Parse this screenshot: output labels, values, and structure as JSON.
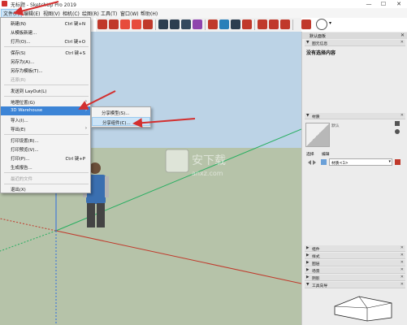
{
  "window": {
    "title": "无标题 - SketchUp Pro 2019",
    "minimize": "—",
    "maximize": "☐",
    "close": "✕"
  },
  "menubar": {
    "items": [
      {
        "label": "文件(F)"
      },
      {
        "label": "编辑(E)"
      },
      {
        "label": "视图(V)"
      },
      {
        "label": "相机(C)"
      },
      {
        "label": "绘图(R)"
      },
      {
        "label": "工具(T)"
      },
      {
        "label": "窗口(W)"
      },
      {
        "label": "帮助(H)"
      }
    ]
  },
  "file_menu": {
    "items": [
      {
        "label": "新建(N)",
        "shortcut": "Ctrl 键+N"
      },
      {
        "label": "从模板新建..."
      },
      {
        "label": "打开(O)...",
        "shortcut": "Ctrl 键+O"
      },
      {
        "label": "保存(S)",
        "shortcut": "Ctrl 键+S"
      },
      {
        "label": "另存为(A)..."
      },
      {
        "label": "另存为模板(T)..."
      },
      {
        "label": "还原(R)"
      },
      {
        "label": "发送到 LayOut(L)"
      },
      {
        "label": "地理位置(G)"
      },
      {
        "label": "3D Warehouse"
      },
      {
        "label": "导入(I)..."
      },
      {
        "label": "导出(E)"
      },
      {
        "label": "打印设置(R)..."
      },
      {
        "label": "打印预览(V)..."
      },
      {
        "label": "打印(P)...",
        "shortcut": "Ctrl 键+P"
      },
      {
        "label": "生成报告..."
      },
      {
        "label": "最近的文件"
      },
      {
        "label": "退出(X)"
      }
    ]
  },
  "submenu": {
    "items": [
      {
        "label": "分享模型(S)..."
      },
      {
        "label": "分享组件(C)..."
      }
    ]
  },
  "tray": {
    "title": "默认面板",
    "sections": [
      {
        "label": "图元信息"
      },
      {
        "label": "材质"
      },
      {
        "label": "组件"
      },
      {
        "label": "样式"
      },
      {
        "label": "图层"
      },
      {
        "label": "场景"
      },
      {
        "label": "阴影"
      },
      {
        "label": "工具向导"
      }
    ],
    "entity_info_text": "没有选择内容",
    "material_name": "默认",
    "material_tabs": [
      "选择",
      "编辑"
    ],
    "material_dropdown": "材质<1>"
  },
  "watermark": {
    "site": "安下载",
    "url": "anxz.com"
  },
  "colors": {
    "sky": "#bcd3e6",
    "ground": "#b6c3a9",
    "highlight": "#3c84d6",
    "red_axis": "#c0392b",
    "green_axis": "#27ae60",
    "blue_axis": "#2d6cdf",
    "annotation_arrow": "#d32f2f"
  }
}
